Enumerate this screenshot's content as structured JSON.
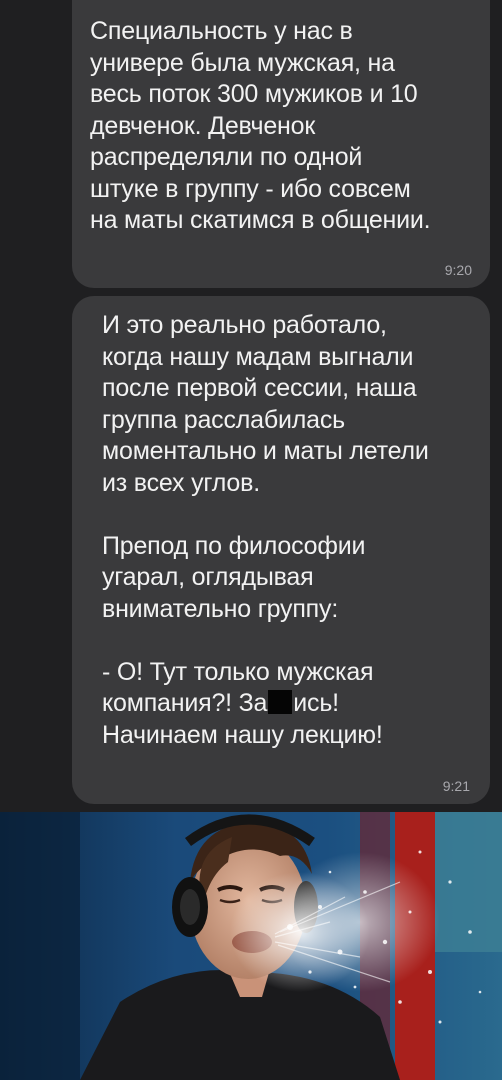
{
  "messages": [
    {
      "lines": [
        "Специальность у нас в",
        "универе была мужская, на",
        "весь поток 300 мужиков и 10",
        "девченок. Девченок",
        "распределяли по одной",
        "штуке в группу - ибо совсем",
        "на маты скатимся в общении."
      ],
      "time": "9:20"
    },
    {
      "lines": [
        "И это реально работало,",
        "когда нашу мадам выгнали",
        "после первой сессии, наша",
        "группа расслабилась",
        "моментально и маты летели",
        "из всех углов.",
        "",
        "Препод по философии",
        "угарал, оглядывая",
        "внимательно группу:",
        "",
        "- О! Тут только мужская"
      ],
      "censored_line": {
        "before": "компания?! За",
        "after": "ись!"
      },
      "last_line": "Начинаем нашу лекцию!",
      "time": "9:21"
    }
  ],
  "photo": {
    "description_icon": "man-with-headphones-spitting-water",
    "colors": {
      "background_blue": "#1a4a7a",
      "studio_red": "#a8201c",
      "shirt": "#1a1a1c"
    }
  }
}
